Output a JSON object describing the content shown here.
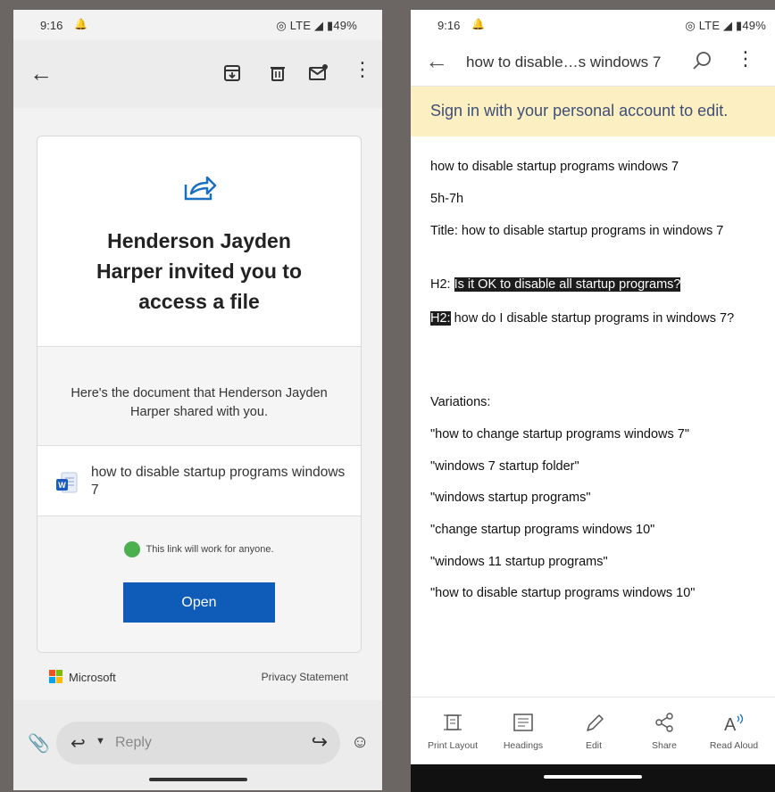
{
  "left": {
    "status": {
      "time": "9:16",
      "right": "◎ LTE ◢ ▮49%"
    },
    "invite_lines": [
      "Henderson Jayden",
      "Harper invited you to",
      "access a file"
    ],
    "shared_text": "Here's the document that Henderson Jayden Harper shared with you.",
    "file_name": "how to disable startup programs windows 7",
    "link_note": "This link will work for anyone.",
    "open_label": "Open",
    "microsoft_label": "Microsoft",
    "privacy_label": "Privacy Statement",
    "reply_placeholder": "Reply"
  },
  "right": {
    "status": {
      "time": "9:16",
      "right": "◎ LTE ◢ ▮49%"
    },
    "doc_title": "how to disable…s windows 7",
    "signin_banner": "Sign in with your personal account to edit.",
    "lines": {
      "l1": "how to disable startup programs windows 7",
      "l2": "5h-7h",
      "l3": "Title: how to disable startup programs in windows 7",
      "l4_prefix": "H2: ",
      "l4_highlight": "Is it OK to disable all startup programs?",
      "l5_highlight": "H2:",
      "l5_rest": " how do I disable startup programs in windows 7?",
      "l6": "Variations:",
      "l7": "\"how to change startup programs windows 7\"",
      "l8": "\"windows 7 startup folder\"",
      "l9": "\"windows startup programs\"",
      "l10": "\"change startup programs windows 10\"",
      "l11": "\"windows 11 startup programs\"",
      "l12": "\"how to disable startup programs windows 10\""
    },
    "toolbar": [
      "Print Layout",
      "Headings",
      "Edit",
      "Share",
      "Read Aloud"
    ]
  },
  "colors": {
    "open_button": "#0f5cb8",
    "signin_bg": "#fcefc2",
    "highlight": "#1c1c1c"
  }
}
